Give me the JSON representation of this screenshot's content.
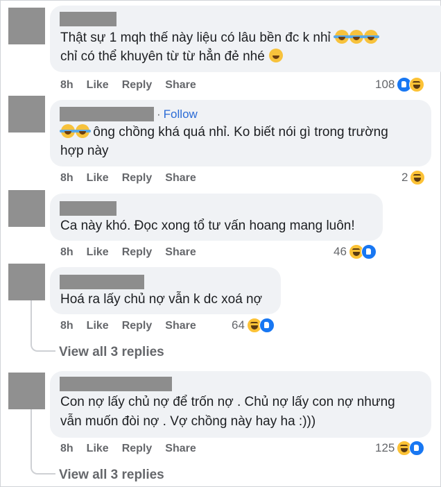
{
  "actions": {
    "time": "8h",
    "like": "Like",
    "reply": "Reply",
    "share": "Share"
  },
  "comments": [
    {
      "lines": [
        "Thật sự 1 mqh thế này liệu có lâu bền đc k nhỉ",
        "chỉ có thể khuyên từ từ hẳn đẻ nhé"
      ],
      "count": "108",
      "follow": ""
    },
    {
      "lines": [
        "ông chồng khá quá nhỉ. Ko biết nói gì trong trường",
        "hợp này"
      ],
      "count": "2",
      "follow": "Follow"
    },
    {
      "lines": [
        "Ca này khó. Đọc xong tổ tư vấn hoang mang luôn!"
      ],
      "count": "46",
      "follow": ""
    },
    {
      "lines": [
        "Hoá ra lấy chủ nợ vẫn k dc xoá nợ"
      ],
      "count": "64",
      "follow": ""
    },
    {
      "lines": [
        "Con nợ lấy chủ nợ để trốn nợ . Chủ nợ lấy con nợ nhưng",
        "vẫn muốn đòi nợ . Vợ chồng này hay ha :)))"
      ],
      "count": "125",
      "follow": ""
    }
  ],
  "view_replies": [
    "View all 3 replies",
    "View all 3 replies"
  ],
  "follow_dot": "·"
}
